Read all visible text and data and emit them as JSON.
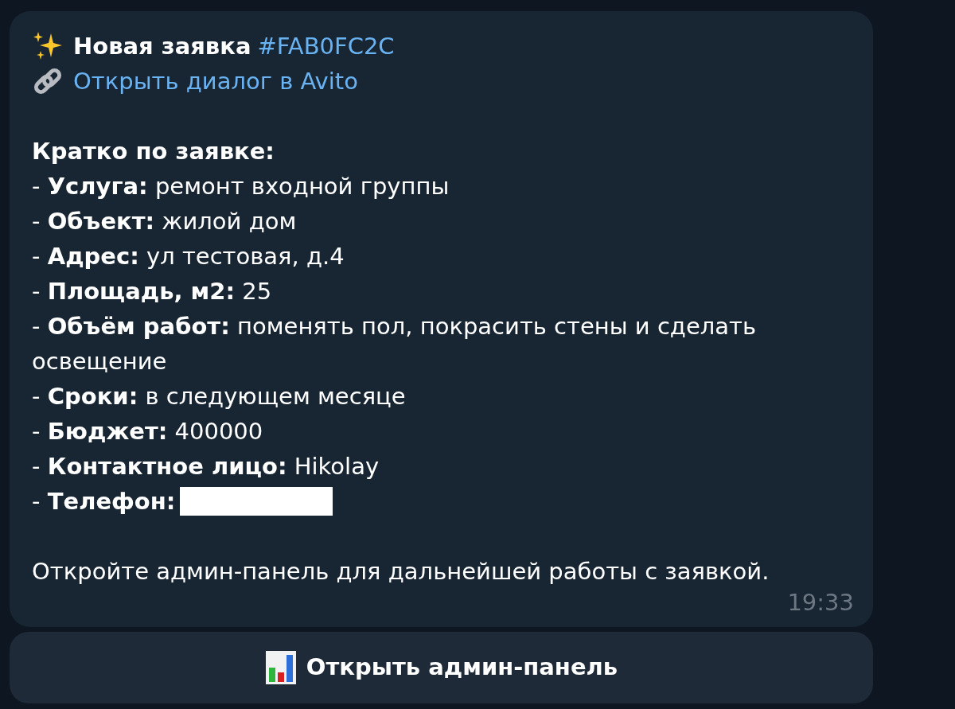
{
  "message": {
    "title": "Новая заявка",
    "tag": "#FAB0FC2C",
    "link": "Открыть диалог в Avito",
    "summary_heading": "Кратко по заявке:",
    "lines": [
      {
        "text": "- **Услуга:** ремонт входной группы",
        "redacted": false
      },
      {
        "text": "- **Объект:** жилой дом",
        "redacted": false
      },
      {
        "text": "- **Адрес:** ул тестовая, д.4",
        "redacted": false
      },
      {
        "text": "- **Площадь, м2:** 25",
        "redacted": false
      },
      {
        "text": "- **Объём работ:** поменять пол, покрасить стены и сделать освещение",
        "redacted": false
      },
      {
        "text": "- **Сроки:** в следующем месяце",
        "redacted": false
      },
      {
        "text": "- **Бюджет:** 400000",
        "redacted": false
      },
      {
        "text": "- **Контактное лицо:** Hikolay",
        "redacted": false
      },
      {
        "text": "- **Телефон:**",
        "redacted": true
      }
    ],
    "footer": "Откройте админ-панель для дальнейшей работы с заявкой.",
    "time": "19:33"
  },
  "button": {
    "label": "Открыть админ-панель"
  }
}
